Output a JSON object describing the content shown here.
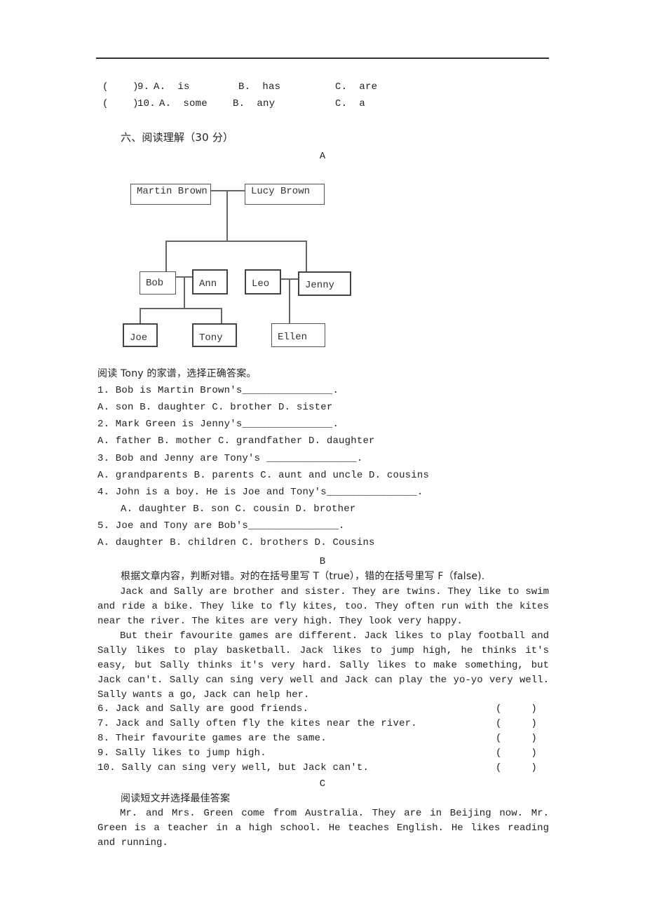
{
  "prev_questions": [
    {
      "paren": "(    )",
      "num": "9.",
      "a": "A.  is",
      "b": "B.  has",
      "c": "C.  are"
    },
    {
      "paren": "(    )",
      "num": "10.",
      "a": "A.  some",
      "b": "B.  any",
      "c": "C.  a"
    }
  ],
  "section": {
    "title": "六、阅读理解（30 分）"
  },
  "part_a": {
    "label": "A",
    "family_tree": {
      "grandparents": [
        "Martin Brown",
        "Lucy Brown"
      ],
      "left_couple": [
        "Bob",
        "Ann"
      ],
      "right_couple": [
        "Leo",
        "Jenny"
      ],
      "left_children": [
        "Joe",
        "Tony"
      ],
      "right_children": [
        "Ellen"
      ]
    },
    "instruction": "阅读 Tony 的家谱，选择正确答案。",
    "questions": [
      {
        "q": "1. Bob is Martin Brown's_______________.",
        "options": "A. son B. daughter C. brother D. sister"
      },
      {
        "q": "2. Mark Green is Jenny's_______________.",
        "options": "A. father B. mother C. grandfather D. daughter"
      },
      {
        "q": "3. Bob and Jenny are Tony's _______________.",
        "options": "A. grandparents B. parents C. aunt and uncle D. cousins"
      },
      {
        "q": "4. John is a boy. He is Joe and Tony's_______________.",
        "options": "A. daughter B. son C. cousin D. brother"
      },
      {
        "q": "5. Joe and Tony are Bob's_______________.",
        "options": "A. daughter B. children C. brothers D. Cousins"
      }
    ]
  },
  "part_b": {
    "label": "B",
    "instruction": "根据文章内容，判断对错。对的在括号里写 T（true），错的在括号里写 F（false).",
    "paragraphs": [
      "Jack and Sally are brother and sister. They are twins. They like to swim and ride a bike. They like to fly kites, too. They often run with the kites near the river. The kites are very high. They look very happy.",
      "But their favourite games are different. Jack likes to play football and Sally likes to play basketball. Jack likes to jump high, he thinks it's easy, but Sally thinks it's very hard. Sally likes to make something, but Jack can't. Sally can sing very well and Jack can play the yo-yo very well. Sally wants a go, Jack can help her."
    ],
    "statements": [
      "6. Jack and Sally are good friends.",
      "7. Jack and Sally often fly the kites near the river.",
      "8. Their favourite games are the same.",
      "9. Sally likes to jump high.",
      "10. Sally can sing very well, but Jack can't."
    ],
    "answer_paren": "(     )"
  },
  "part_c": {
    "label": "C",
    "instruction": "阅读短文并选择最佳答案",
    "paragraph": "Mr. and Mrs. Green come from Australia. They are in Beijing now. Mr. Green is a teacher in a high school. He teaches English. He likes reading and running."
  }
}
